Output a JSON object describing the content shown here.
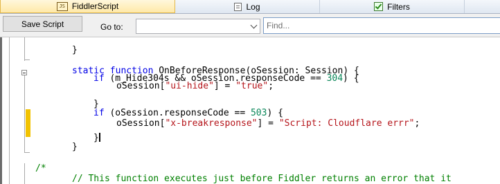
{
  "tabs": {
    "script_label": "FiddlerScript",
    "log_label": "Log",
    "filters_label": "Filters"
  },
  "toolbar": {
    "save_label": "Save Script",
    "goto_label": "Go to:",
    "goto_value": "",
    "find_placeholder": "Find..."
  },
  "editor": {
    "lines": [
      [
        [
          "",
          "}"
        ]
      ],
      [
        [
          "kw",
          "static function"
        ],
        [
          "",
          " OnBeforeResponse(oSession: Session) {"
        ]
      ],
      [
        [
          "kw",
          "if"
        ],
        [
          "",
          " (m_Hide304s && oSession.responseCode == "
        ],
        [
          "num",
          "304"
        ],
        [
          "",
          ") {"
        ]
      ],
      [
        [
          "",
          "oSession["
        ],
        [
          "str",
          "\"ui-hide\""
        ],
        [
          "",
          "] = "
        ],
        [
          "str",
          "\"true\""
        ],
        [
          "",
          ";"
        ]
      ],
      [
        [
          "",
          "}"
        ]
      ],
      [
        [
          "kw",
          "if"
        ],
        [
          "",
          " (oSession.responseCode == "
        ],
        [
          "num",
          "503"
        ],
        [
          "",
          ") {"
        ]
      ],
      [
        [
          "",
          "oSession["
        ],
        [
          "str",
          "\"x-breakresponse\""
        ],
        [
          "",
          "] = "
        ],
        [
          "str",
          "\"Script: Cloudflare errr\""
        ],
        [
          "",
          ";"
        ]
      ],
      [
        [
          "",
          "}"
        ]
      ],
      [
        [
          "",
          "}"
        ]
      ],
      [
        [
          "cm",
          "/*"
        ]
      ],
      [
        [
          "cm",
          "// This function executes just before Fiddler returns an error that it"
        ]
      ]
    ]
  }
}
